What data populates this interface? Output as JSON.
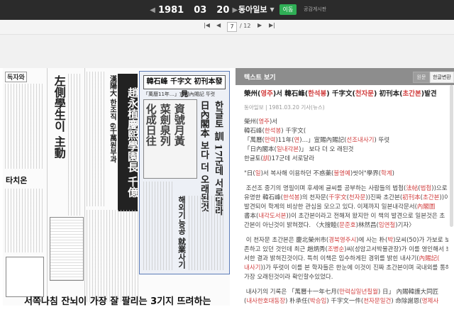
{
  "date": {
    "year": "1981",
    "month": "03",
    "day": "20"
  },
  "newspaper": "동아일보",
  "move_button": "이동",
  "share_label": "공감게시판",
  "pager": {
    "current": "7",
    "total": "/ 12"
  },
  "panel": {
    "title": "텍스트 보기",
    "tab_original": "원문",
    "tab_hangul": "한글변환",
    "article_title_parts": [
      "榮州(",
      "영주",
      ")서 韓石峰(",
      "한석봉",
      ") 千字文(",
      "천자문",
      ") 初刊本(",
      "초간본",
      ")발견"
    ],
    "meta": "동아일보 | 1981.03.20 기사(뉴스)",
    "paragraphs": [
      [
        "榮州(",
        "영주",
        ")서"
      ],
      [
        "韓石峰(",
        "한석봉",
        ") 千字文(",
        "천자문초간본",
        ")발견"
      ],
      [
        "「萬曆(",
        "만력",
        ")11年(",
        "연",
        ")…」宣賜內賜記(",
        "선조내사기",
        ") 뚜렷"
      ],
      [
        "「日內閣本(",
        "일내각본",
        ")」 보다 더 오 래된것"
      ],
      [
        "한글토(",
        "訓",
        ")17군데 서로달라"
      ]
    ],
    "para2": [
      "\"日(",
      "일",
      ")서 복사해 이용하던 不惑藥(",
      "불영예",
      ")씻어\"學界(",
      "학계",
      ")"
    ],
    "para3": [
      [
        "조선조 중기의 명필이며 후세에 글씨를 공부하는 사람들의 법첩(",
        "法帖",
        "(",
        "법첩",
        "))으로"
      ],
      [
        "유명한 韓石峰(",
        "한석봉",
        ")의 천자문(",
        "千字文",
        "(",
        "천자문",
        "))진짜 초간본(",
        "初刊本",
        "(",
        "초간본",
        "))이"
      ],
      [
        "발견되어 학계의 비상한 관심을 모으고 있다. 이제까지 일본내각문서(",
        "內閣圖",
        ""
      ],
      [
        "書本(",
        "내각도서본",
        "))이 초간본이라고 전해져 왔지만 이 책의 발견으로 일본것은 초"
      ],
      [
        "간본이 아닌것이 밝혀졌다. 〈大搜睦(",
        "문준호",
        ")林然昌(",
        "임연철",
        ")기자〉",
        ""
      ]
    ],
    "para4": [
      [
        "이 천자문 초간본은 慶北榮州市(",
        "경북영주시",
        ")에 사는 朴(",
        "박",
        ")모씨(50)가 가보로 보"
      ],
      [
        "존하고 있던 것인데 최근 趙炳秀(",
        "조병순",
        ")씨(성암고서박물관장)가 이를 영인해서 보"
      ],
      [
        "서한 결과 밝혀진것이다. 특히 이책은 임수하게된 경위를 밝힌 내사기(",
        "內賜記(",
        ""
      ],
      [
        "내사기",
        "))가 뚜렷이 이를 본 학자들은 한눈에 이것이 진짜 초간본이며 국내외를 통해"
      ],
      [
        "가장 오래된것이라 확인할수있었다.",
        "",
        ""
      ]
    ],
    "para5": [
      [
        "내사기의 기록은 「萬曆十一年七月(",
        "만력십일년칠월",
        ") 日」 內賜韓護大同匠"
      ],
      [
        "(",
        "내사한호대동장",
        ") 朴承任(",
        "박승임",
        ") 千字文一件(",
        "천자문일건",
        ") 命除謝恩(",
        "명제사",
        ""
      ]
    ]
  },
  "paper_texts": {
    "masthead_logo": "독자와",
    "left_headline": "左側學生이 主動",
    "left_small": "타치온",
    "middle_head1": "趙永植慶熙學園長 千億",
    "middle_head2": "漢陽大 한조직 6千萬원부과",
    "center_box_title": "韓石峰 千字文 初刊本發見",
    "center_box_sub": "「萬曆11年…」宣賜內賜記 뚜렷",
    "big_vertical": "日內閣本 보다 더 오래된것",
    "big_vertical2": "한글토 訓 17군데 서로달라",
    "side_head": "해외기능공 就業사기",
    "bottom_headline": "서쪽나침 잔뇌이 가장 잘 팔리는 3기지 뜨려하는"
  }
}
